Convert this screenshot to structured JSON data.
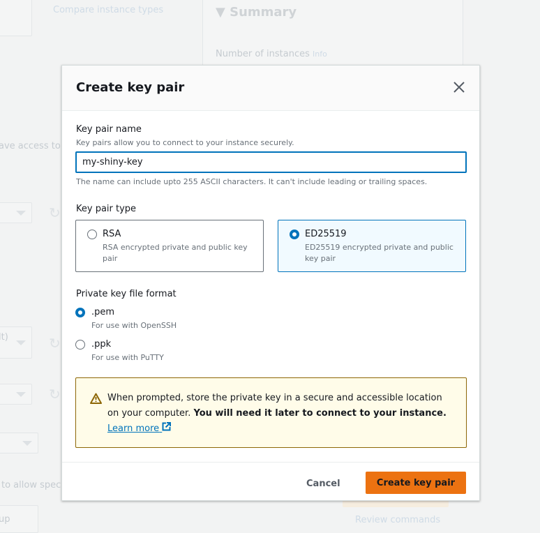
{
  "background": {
    "compare_link": "Compare instance types",
    "summary_title": "Summary",
    "number_of_instances": "Number of instances",
    "info": "Info",
    "access_text": "ave access to t",
    "default_fragment": "lt)",
    "allow_text": "to allow specifi",
    "group_fragment": "up",
    "review_commands": "Review commands"
  },
  "modal": {
    "title": "Create key pair",
    "close_icon": "close-icon",
    "name_label": "Key pair name",
    "name_desc": "Key pairs allow you to connect to your instance securely.",
    "name_value": "my-shiny-key",
    "name_constraint": "The name can include upto 255 ASCII characters. It can't include leading or trailing spaces.",
    "type_label": "Key pair type",
    "types": [
      {
        "label": "RSA",
        "desc": "RSA encrypted private and public key pair",
        "selected": false
      },
      {
        "label": "ED25519",
        "desc": "ED25519 encrypted private and public key pair",
        "selected": true
      }
    ],
    "format_label": "Private key file format",
    "formats": [
      {
        "label": ".pem",
        "desc": "For use with OpenSSH",
        "selected": true
      },
      {
        "label": ".ppk",
        "desc": "For use with PuTTY",
        "selected": false
      }
    ],
    "alert": {
      "icon": "warning-icon",
      "text": "When prompted, store the private key in a secure and accessible location on your computer. ",
      "bold": "You will need it later to connect to your instance.",
      "link": "Learn more"
    },
    "cancel": "Cancel",
    "create": "Create key pair"
  },
  "colors": {
    "primary": "#ec7211",
    "selected": "#0073bb",
    "warning": "#8d6605"
  }
}
